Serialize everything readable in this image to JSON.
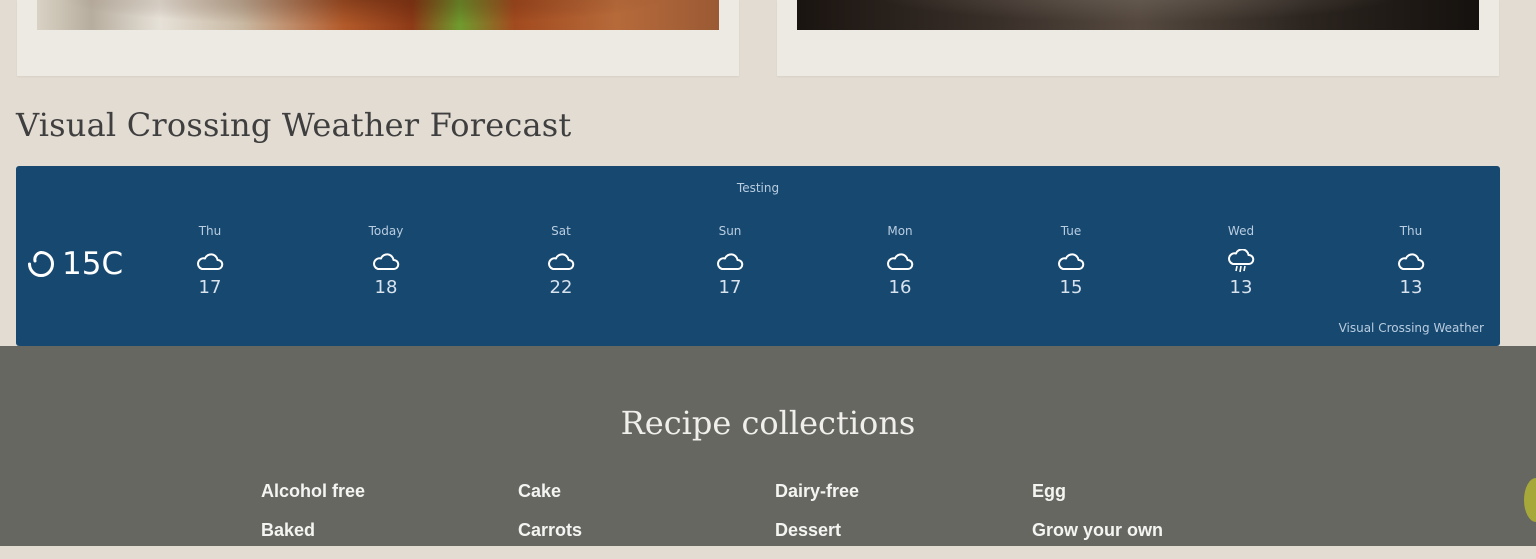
{
  "forecast": {
    "heading": "Visual Crossing Weather Forecast",
    "widget": {
      "title": "Testing",
      "current_temp": "15C",
      "current_icon": "partly-moon-icon",
      "days": [
        {
          "label": "Thu",
          "icon": "cloud-icon",
          "temp": "17"
        },
        {
          "label": "Today",
          "icon": "cloud-icon",
          "temp": "18"
        },
        {
          "label": "Sat",
          "icon": "cloud-icon",
          "temp": "22"
        },
        {
          "label": "Sun",
          "icon": "cloud-icon",
          "temp": "17"
        },
        {
          "label": "Mon",
          "icon": "cloud-icon",
          "temp": "16"
        },
        {
          "label": "Tue",
          "icon": "cloud-icon",
          "temp": "15"
        },
        {
          "label": "Wed",
          "icon": "rain-cloud-icon",
          "temp": "13"
        },
        {
          "label": "Thu",
          "icon": "cloud-icon",
          "temp": "13"
        }
      ],
      "credit": "Visual Crossing Weather"
    }
  },
  "collections": {
    "heading": "Recipe collections",
    "columns": [
      [
        "Alcohol free",
        "Baked"
      ],
      [
        "Cake",
        "Carrots"
      ],
      [
        "Dairy-free",
        "Dessert"
      ],
      [
        "Egg",
        "Grow your own"
      ]
    ]
  },
  "colors": {
    "page_bg": "#e3dcd3",
    "widget_bg": "#174870",
    "footer_bg": "#676762"
  }
}
